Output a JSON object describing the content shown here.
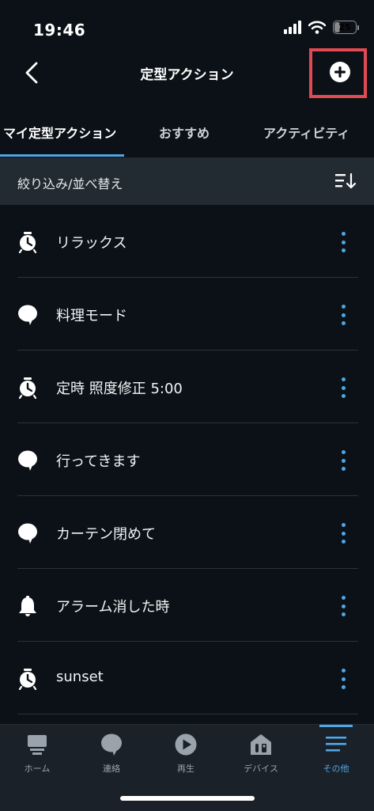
{
  "status_bar": {
    "time": "19:46",
    "battery": "25",
    "battery_level": 0.25
  },
  "header": {
    "title": "定型アクション",
    "back_icon": "chevron-left-icon",
    "add_icon": "plus-circle-icon"
  },
  "tabs": [
    {
      "label": "マイ定型アクション",
      "active": true
    },
    {
      "label": "おすすめ",
      "active": false
    },
    {
      "label": "アクティビティ",
      "active": false
    }
  ],
  "filter": {
    "label": "絞り込み/並べ替え",
    "icon": "sort-icon"
  },
  "routines": [
    {
      "label": "リラックス",
      "icon": "alarm-clock-icon"
    },
    {
      "label": "料理モード",
      "icon": "speech-bubble-icon"
    },
    {
      "label": "定時 照度修正 5:00",
      "icon": "alarm-clock-icon"
    },
    {
      "label": "行ってきます",
      "icon": "speech-bubble-icon"
    },
    {
      "label": "カーテン閉めて",
      "icon": "speech-bubble-icon"
    },
    {
      "label": "アラーム消した時",
      "icon": "bell-icon"
    },
    {
      "label": "sunset",
      "icon": "alarm-clock-icon"
    }
  ],
  "tab_bar": [
    {
      "label": "ホーム",
      "icon": "home-icon",
      "active": false
    },
    {
      "label": "連絡",
      "icon": "chat-icon",
      "active": false
    },
    {
      "label": "再生",
      "icon": "play-icon",
      "active": false
    },
    {
      "label": "デバイス",
      "icon": "devices-icon",
      "active": false
    },
    {
      "label": "その他",
      "icon": "menu-icon",
      "active": true
    }
  ],
  "colors": {
    "background": "#0b1116",
    "accent": "#4fa6e8",
    "highlight": "#e04a52",
    "filter_bar": "#222a32",
    "tab_bar": "#1a2128"
  }
}
